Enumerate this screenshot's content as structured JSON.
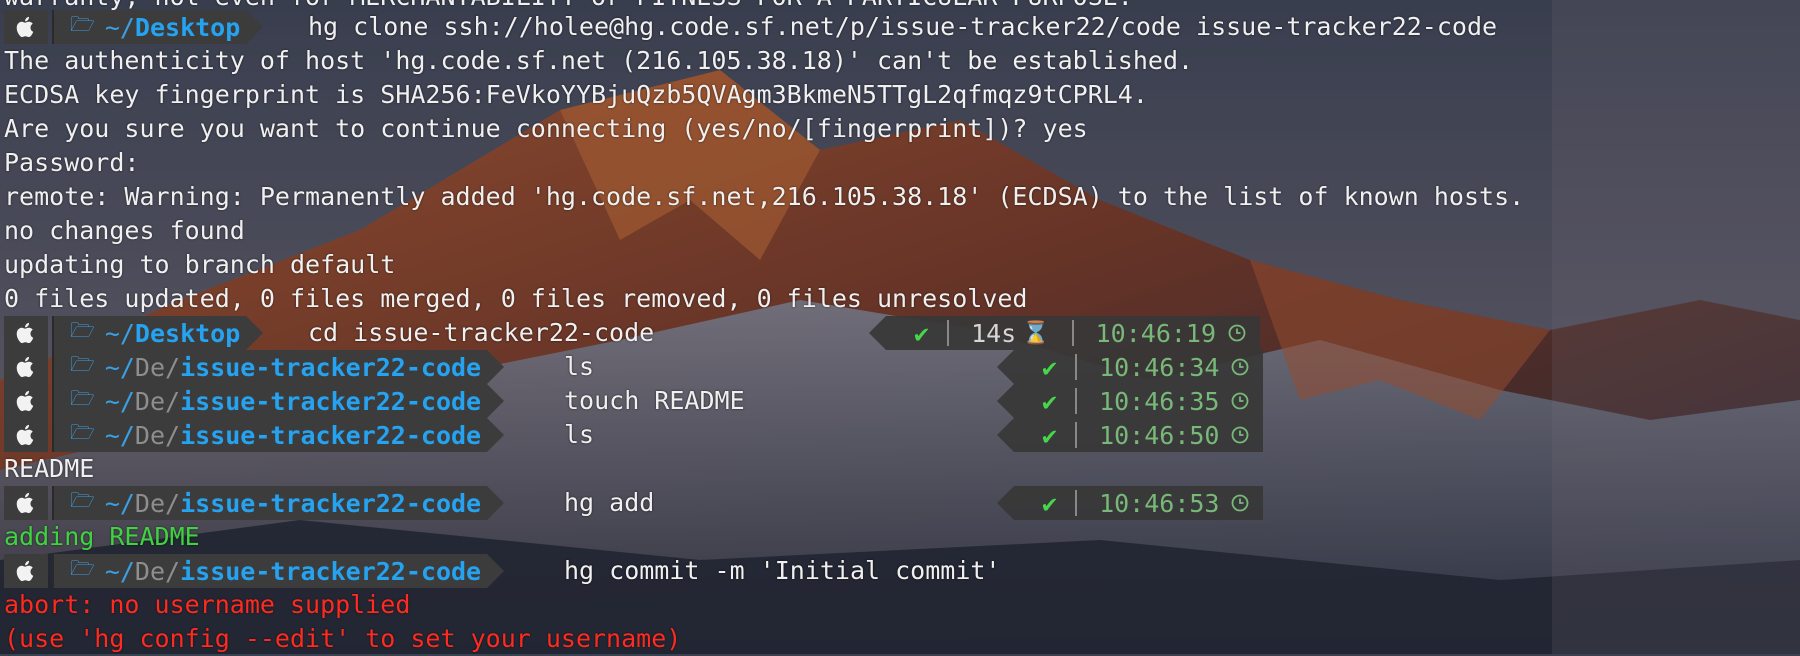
{
  "terminal": {
    "top_partial": "warranty, not even for MERCHANTABILITY or FITNESS FOR A PARTICULAR PURPOSE.",
    "clone_prompt": {
      "dir_home": "~/",
      "dir_name": "Desktop",
      "command": "hg clone ssh://holee@hg.code.sf.net/p/issue-tracker22/code issue-tracker22-code"
    },
    "output1": [
      "The authenticity of host 'hg.code.sf.net (216.105.38.18)' can't be established.",
      "ECDSA key fingerprint is SHA256:FeVkoYYBjuQzb5QVAgm3BkmeN5TTgL2qfmqz9tCPRL4.",
      "Are you sure you want to continue connecting (yes/no/[fingerprint])? yes",
      "Password:",
      "remote: Warning: Permanently added 'hg.code.sf.net,216.105.38.18' (ECDSA) to the list of known hosts.",
      "no changes found",
      "updating to branch default",
      "0 files updated, 0 files merged, 0 files removed, 0 files unresolved"
    ],
    "cd_prompt": {
      "dir_home": "~/",
      "dir_name": "Desktop",
      "command": "cd issue-tracker22-code",
      "status": "✔",
      "duration": "14s",
      "duration_icon": "⌛",
      "time": "10:46:19"
    },
    "prompts": [
      {
        "dir_home": "~/",
        "dir_mid": "De/",
        "dir_name": "issue-tracker22-code",
        "command": "ls",
        "status": "✔",
        "time": "10:46:34"
      },
      {
        "dir_home": "~/",
        "dir_mid": "De/",
        "dir_name": "issue-tracker22-code",
        "command": "touch README",
        "status": "✔",
        "time": "10:46:35"
      },
      {
        "dir_home": "~/",
        "dir_mid": "De/",
        "dir_name": "issue-tracker22-code",
        "command": "ls",
        "status": "✔",
        "time": "10:46:50"
      }
    ],
    "ls_output": "README",
    "add_prompt": {
      "dir_home": "~/",
      "dir_mid": "De/",
      "dir_name": "issue-tracker22-code",
      "command": "hg add",
      "status": "✔",
      "time": "10:46:53"
    },
    "add_output": "adding README",
    "commit_prompt": {
      "dir_home": "~/",
      "dir_mid": "De/",
      "dir_name": "issue-tracker22-code",
      "command": "hg commit -m 'Initial commit'"
    },
    "errors": [
      "abort: no username supplied",
      "(use 'hg config --edit' to set your username)"
    ]
  },
  "icons": {
    "prompt_os": "apple-icon",
    "prompt_folder": "folder-icon",
    "status_clock": "clock-icon",
    "status_duration": "hourglass-icon"
  },
  "colors": {
    "path_blue": "#26a3f0",
    "ok_green": "#46d64a",
    "time_green": "#78b878",
    "error_red": "#ff2a20",
    "added_green": "#3fd43f",
    "segment_bg": "#3c3c3c"
  }
}
